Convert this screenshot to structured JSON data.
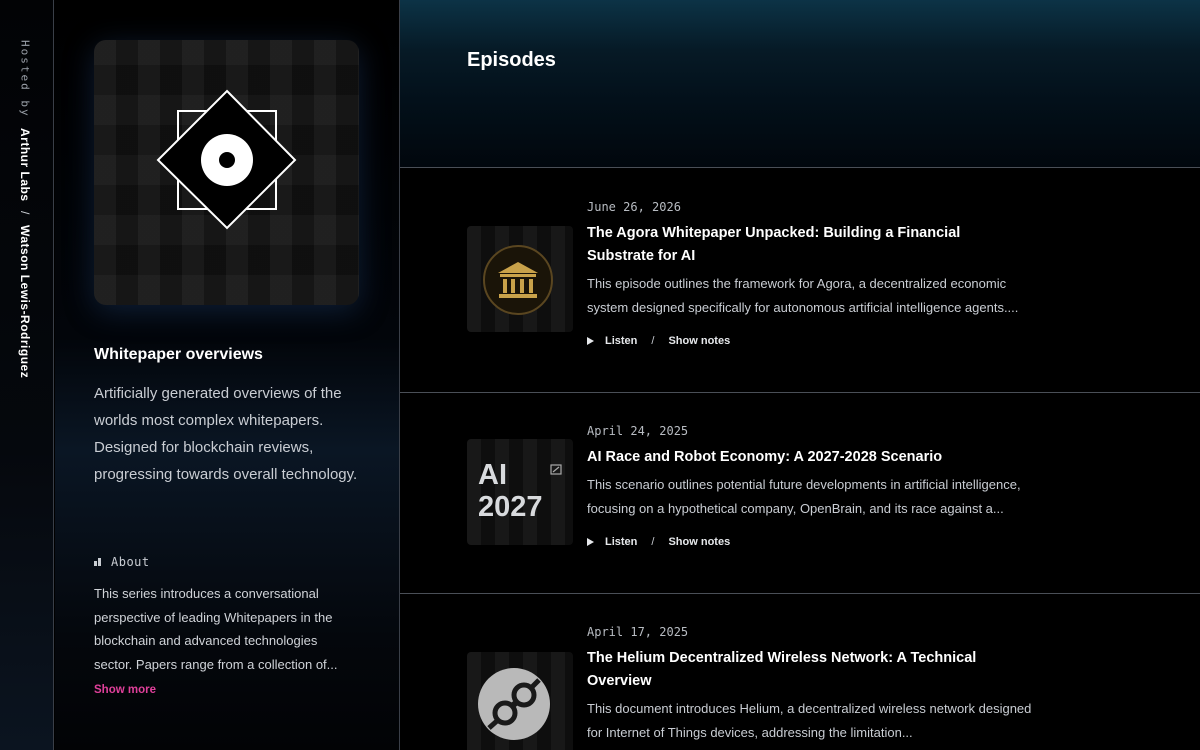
{
  "host": {
    "prefix": "Hosted by",
    "org": "Arthur Labs",
    "separator": "/",
    "person": "Watson Lewis-Rodriguez"
  },
  "series": {
    "title": "Whitepaper overviews",
    "description": "Artificially generated overviews of the worlds most complex whitepapers. Designed for blockchain reviews, progressing towards overall technology.",
    "about_label": "About",
    "about_text": "This series introduces a conversational perspective of leading Whitepapers in the blockchain and advanced technologies sector. Papers range from a collection of...",
    "show_more": "Show more"
  },
  "main": {
    "title": "Episodes",
    "listen_label": "Listen",
    "show_notes_label": "Show notes",
    "action_separator": "/"
  },
  "episodes": [
    {
      "date": "June 26, 2026",
      "title": "The Agora Whitepaper Unpacked: Building a Financial Substrate for AI",
      "description": "This episode outlines the framework for Agora, a decentralized economic system designed specifically for autonomous artificial intelligence agents....",
      "thumb_icon": "bank-icon"
    },
    {
      "date": "April 24, 2025",
      "title": "AI Race and Robot Economy: A 2027-2028 Scenario",
      "description": "This scenario outlines potential future developments in artificial intelligence, focusing on a hypothetical company, OpenBrain, and its race against a...",
      "thumb_text_line1": "AI",
      "thumb_text_line2": "2027"
    },
    {
      "date": "April 17, 2025",
      "title": "The Helium Decentralized Wireless Network: A Technical Overview",
      "description": "This document introduces Helium, a decentralized wireless network designed for Internet of Things devices, addressing the limitation...",
      "thumb_icon": "helium-logo-icon"
    }
  ],
  "colors": {
    "accent_pink": "#e0409a",
    "gold": "#c9a24a",
    "header_teal": "#0c3346"
  }
}
